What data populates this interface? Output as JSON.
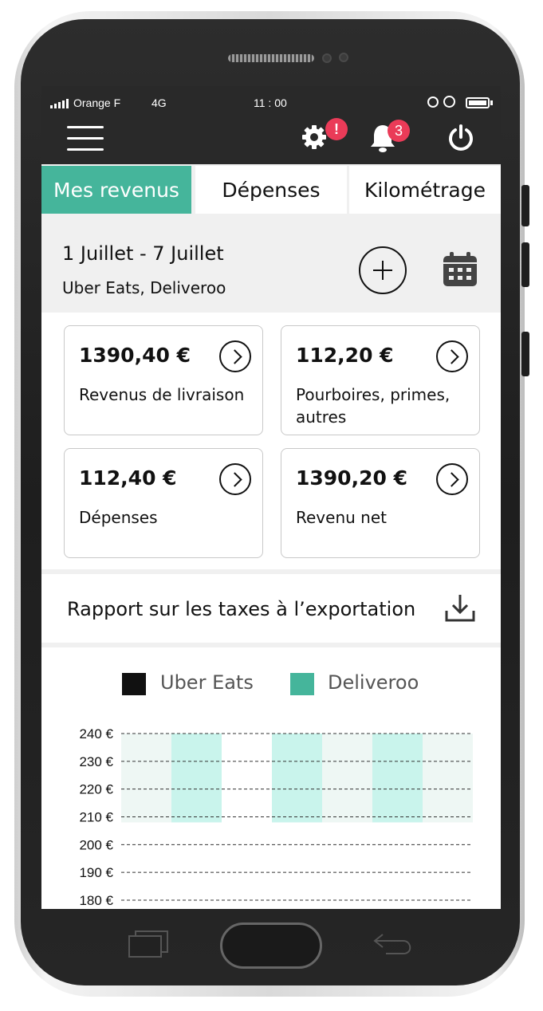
{
  "status_bar": {
    "carrier": "Orange F",
    "network": "4G",
    "time": "11 : 00"
  },
  "app_bar": {
    "settings_badge": "!",
    "notifications_badge": "3"
  },
  "tabs": [
    {
      "label": "Mes revenus",
      "active": true
    },
    {
      "label": "Dépenses",
      "active": false
    },
    {
      "label": "Kilométrage",
      "active": false
    }
  ],
  "period": {
    "title": "1 Juillet - 7 Juillet",
    "platforms": "Uber Eats, Deliveroo"
  },
  "cards": [
    {
      "amount": "1390,40 €",
      "label": "Revenus de livraison"
    },
    {
      "amount": "112,20 €",
      "label": "Pourboires, primes, autres"
    },
    {
      "amount": "112,40 €",
      "label": "Dépenses"
    },
    {
      "amount": "1390,20 €",
      "label": "Revenu net"
    }
  ],
  "export": {
    "label": "Rapport sur les taxes à l’exportation"
  },
  "colors": {
    "accent": "#45b59b",
    "uber_eats": "#111111",
    "deliveroo": "#45b59b",
    "badge": "#ea3b58"
  },
  "chart_data": {
    "type": "bar",
    "series": [
      {
        "name": "Uber Eats",
        "color": "#111111"
      },
      {
        "name": "Deliveroo",
        "color": "#45b59b"
      }
    ],
    "y_ticks": [
      "240 €",
      "230 €",
      "220 €",
      "210 €",
      "200 €",
      "190 €",
      "180 €"
    ],
    "ylim": [
      180,
      240
    ],
    "grid": true,
    "legend": "top",
    "bands": [
      {
        "from": 208,
        "to": 240,
        "shade": "light"
      },
      {
        "from": 208,
        "to": 240,
        "shade": "mint"
      },
      {
        "from": 208,
        "to": 240,
        "shade": "none"
      },
      {
        "from": 208,
        "to": 240,
        "shade": "mint"
      },
      {
        "from": 208,
        "to": 240,
        "shade": "light"
      },
      {
        "from": 208,
        "to": 240,
        "shade": "mint"
      },
      {
        "from": 208,
        "to": 240,
        "shade": "light"
      }
    ]
  }
}
